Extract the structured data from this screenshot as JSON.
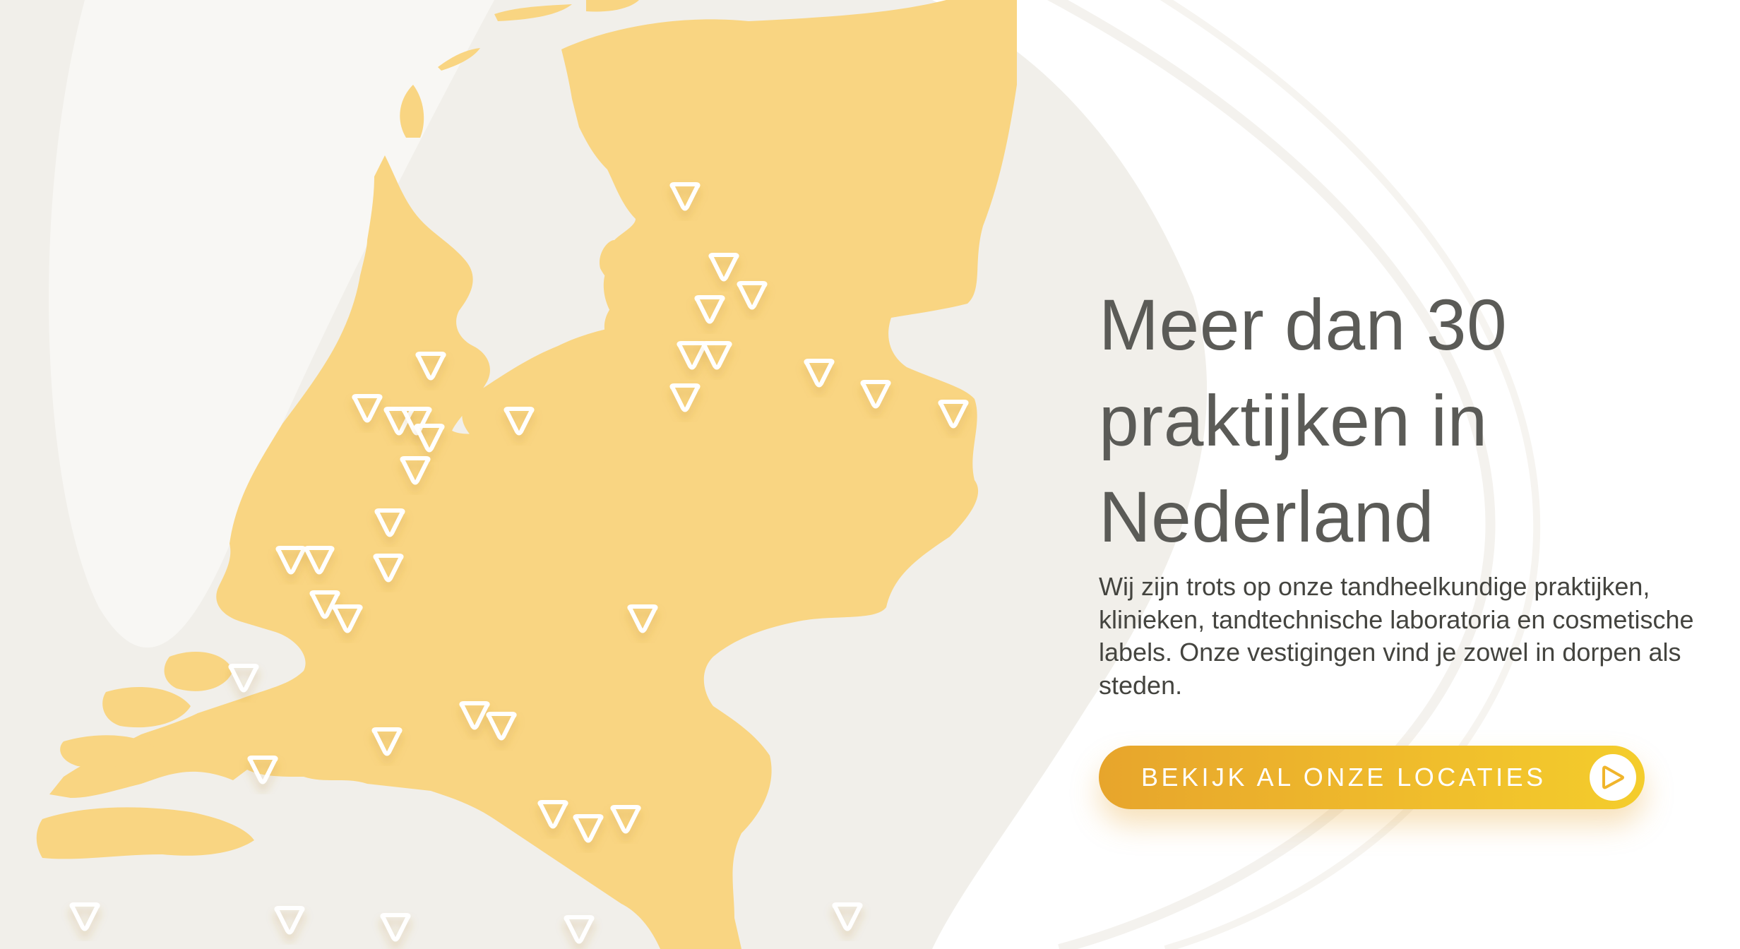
{
  "section": {
    "headline_lines": [
      "Meer dan 30",
      "praktijken in",
      "Nederland"
    ],
    "body": "Wij zijn trots op onze tandheelkundige praktijken, klinieken, tandtechnische laboratoria en cosmetische labels. Onze vestigingen vind je zowel in dorpen als steden.",
    "cta_label": "BEKIJK AL ONZE LOCATIES",
    "cta_icon": "play-triangle-icon"
  },
  "map": {
    "region": "Nederland",
    "marker_icon": "triangle-location-marker-icon",
    "marker_count": 37,
    "land_color": "#f9d582",
    "water_color": "#f7f4ef",
    "marker_color": "#ffffff"
  },
  "colors": {
    "accent_start": "#e7a52c",
    "accent_end": "#f4cd2c",
    "headline": "#5b5b57",
    "body_text": "#44443f",
    "background_swoosh": "#f1efea"
  }
}
